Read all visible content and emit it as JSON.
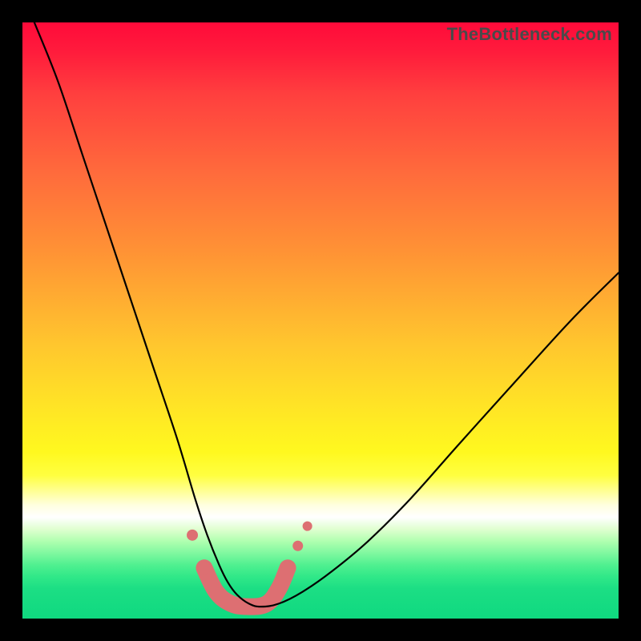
{
  "watermark": "TheBottleneck.com",
  "colors": {
    "black": "#000000",
    "marker": "#dd6f72"
  },
  "chart_data": {
    "type": "line",
    "title": "",
    "xlabel": "",
    "ylabel": "",
    "xlim": [
      0,
      100
    ],
    "ylim": [
      0,
      100
    ],
    "grid": false,
    "curve": {
      "x": [
        2,
        6,
        10,
        14,
        18,
        22,
        26,
        29,
        31,
        33,
        34.5,
        36,
        38,
        40,
        43,
        47,
        52,
        58,
        65,
        73,
        82,
        92,
        100
      ],
      "y": [
        100,
        90,
        78,
        66,
        54,
        42,
        30,
        20,
        14,
        9,
        6,
        4,
        2.5,
        2,
        2.5,
        4.5,
        8,
        13,
        20,
        29,
        39,
        50,
        58
      ]
    },
    "bracket": {
      "x": [
        30.5,
        32.5,
        35,
        38,
        41,
        43,
        44.5
      ],
      "y": [
        8.5,
        4.5,
        2.5,
        2,
        2.5,
        5,
        8.5
      ]
    },
    "dots": [
      {
        "x": 28.5,
        "y": 14,
        "r": 7
      },
      {
        "x": 30.5,
        "y": 8.5,
        "r": 8
      },
      {
        "x": 44.5,
        "y": 8.5,
        "r": 8
      },
      {
        "x": 46.2,
        "y": 12.2,
        "r": 6.5
      },
      {
        "x": 47.8,
        "y": 15.5,
        "r": 6
      }
    ]
  }
}
